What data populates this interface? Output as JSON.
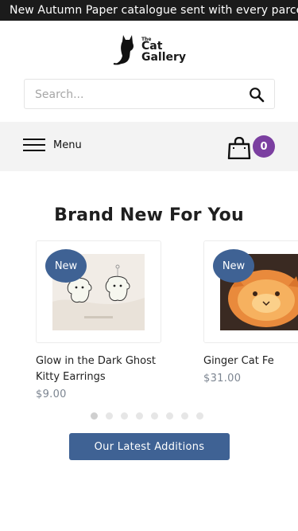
{
  "announcement": "New Autumn Paper catalogue sent with every parcel",
  "logo": {
    "line1": "The",
    "line2": "Cat",
    "line3": "Gallery"
  },
  "search": {
    "placeholder": "Search...",
    "icon": "search-icon"
  },
  "nav": {
    "menu_label": "Menu",
    "cart_count": "0",
    "accent": "#7b3fa0"
  },
  "section": {
    "title": "Brand New For You"
  },
  "products": [
    {
      "badge": "New",
      "name": "Glow in the Dark Ghost Kitty Earrings",
      "price": "$9.00"
    },
    {
      "badge": "New",
      "name": "Ginger Cat Fe",
      "price": "$31.00"
    }
  ],
  "carousel": {
    "dot_count": 8,
    "active_index": 0
  },
  "cta": {
    "label": "Our Latest Additions",
    "color": "#3f6294"
  }
}
